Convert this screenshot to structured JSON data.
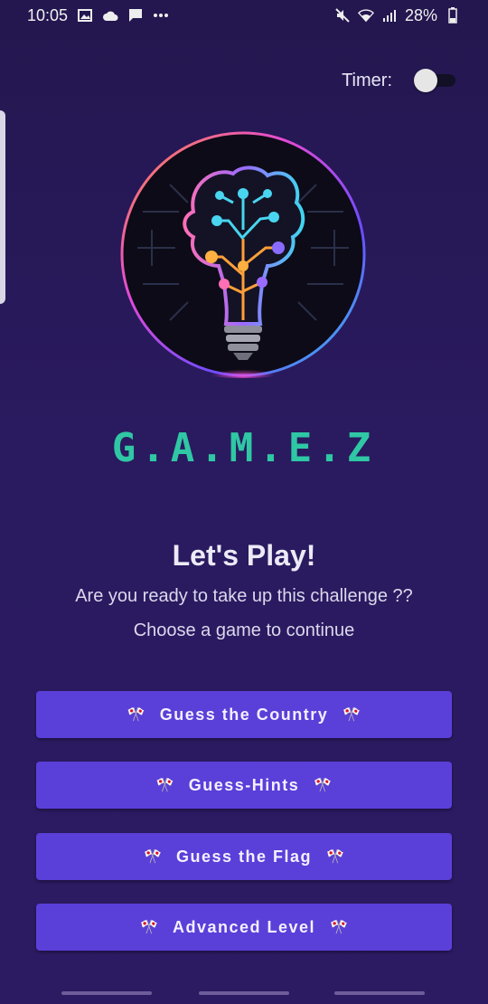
{
  "status_bar": {
    "time": "10:05",
    "battery": "28%",
    "icons_left": [
      "image-icon",
      "cloud-icon",
      "chat-icon",
      "more-icon"
    ],
    "icons_right": [
      "mute-icon",
      "wifi-icon",
      "signal-icon",
      "battery-icon"
    ]
  },
  "timer": {
    "label": "Timer:",
    "enabled": false
  },
  "app": {
    "title": "G.A.M.E.Z",
    "logo": "lightbulb-brain-logo"
  },
  "intro": {
    "headline": "Let's Play!",
    "line1": "Are you ready to take up this challenge ??",
    "line2": "Choose a game to continue"
  },
  "buttons": [
    {
      "label": "Guess the Country",
      "icon": "crossed-flags-icon"
    },
    {
      "label": "Guess-Hints",
      "icon": "crossed-flags-icon"
    },
    {
      "label": "Guess the Flag",
      "icon": "crossed-flags-icon"
    },
    {
      "label": "Advanced Level",
      "icon": "crossed-flags-icon"
    }
  ],
  "flag_glyph": "🎌",
  "colors": {
    "background": "#27195a",
    "button": "#5b3fd9",
    "title": "#2fc7a4"
  }
}
